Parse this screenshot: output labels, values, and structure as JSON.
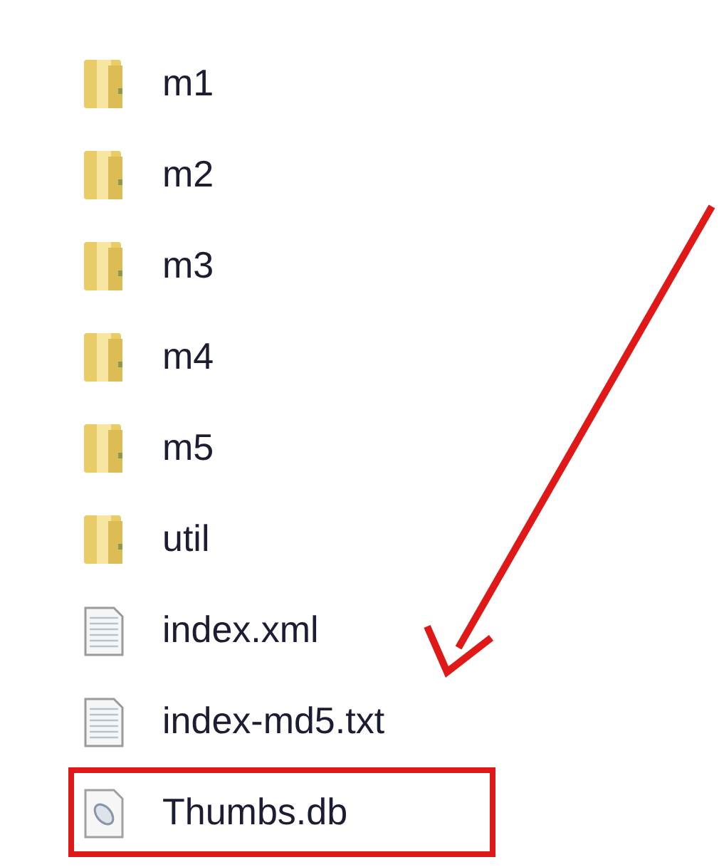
{
  "files": [
    {
      "name": "m1",
      "kind": "folder",
      "highlighted": false
    },
    {
      "name": "m2",
      "kind": "folder",
      "highlighted": false
    },
    {
      "name": "m3",
      "kind": "folder",
      "highlighted": false
    },
    {
      "name": "m4",
      "kind": "folder",
      "highlighted": false
    },
    {
      "name": "m5",
      "kind": "folder",
      "highlighted": false
    },
    {
      "name": "util",
      "kind": "folder",
      "highlighted": false
    },
    {
      "name": "index.xml",
      "kind": "document",
      "highlighted": false
    },
    {
      "name": "index-md5.txt",
      "kind": "document",
      "highlighted": false
    },
    {
      "name": "Thumbs.db",
      "kind": "database",
      "highlighted": true
    }
  ]
}
